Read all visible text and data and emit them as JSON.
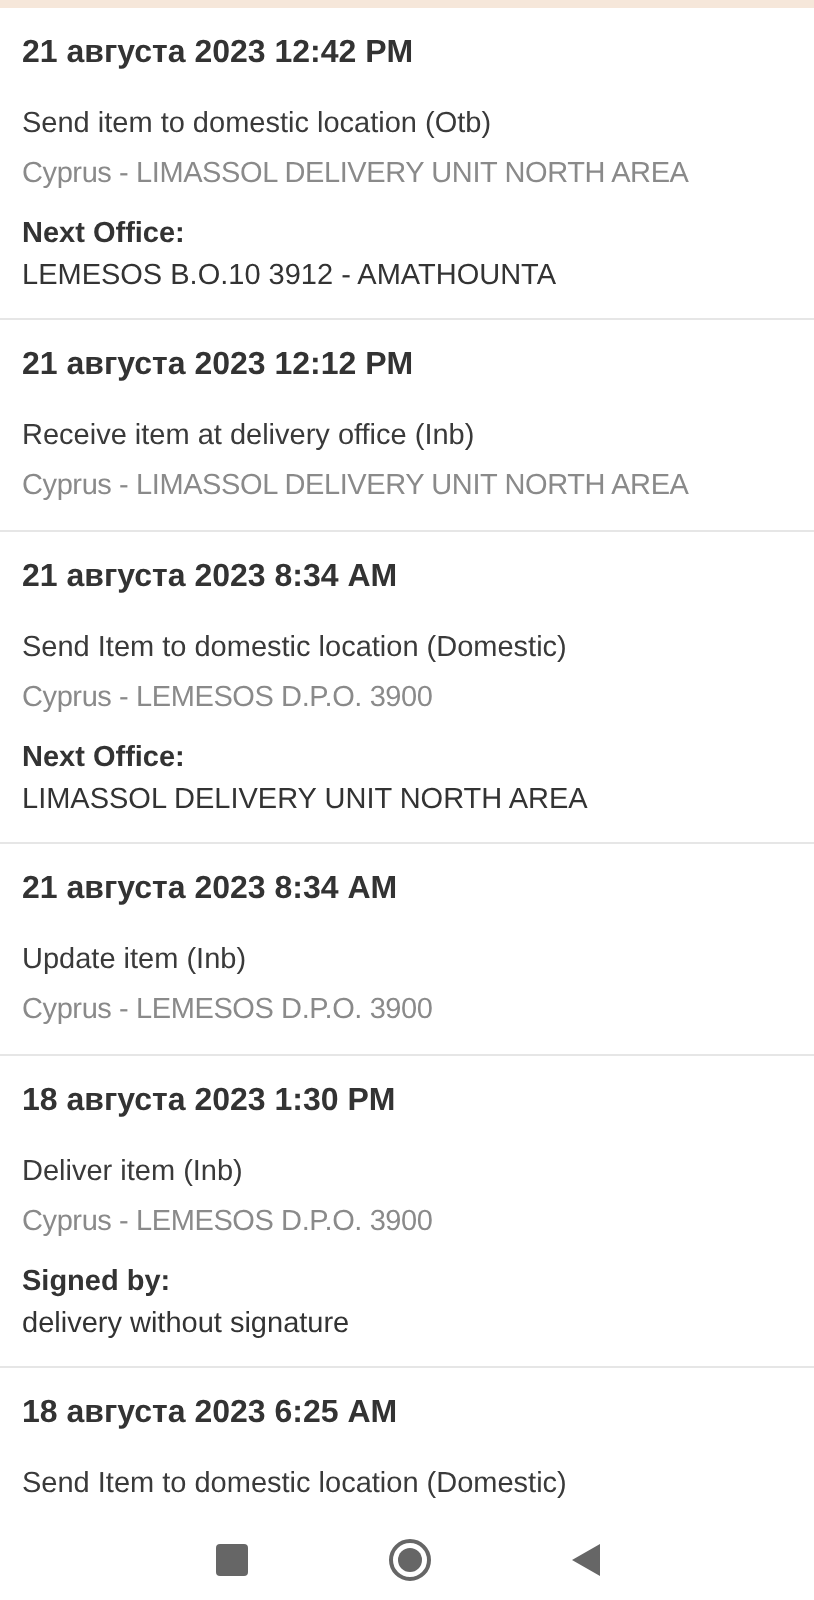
{
  "events": [
    {
      "date": "21 августа 2023 12:42 PM",
      "description": "Send item to domestic location (Otb)",
      "location": "Cyprus - LIMASSOL DELIVERY UNIT NORTH AREA",
      "detail": {
        "label": "Next Office:",
        "value": "LEMESOS B.O.10 3912 - AMATHOUNTA"
      }
    },
    {
      "date": "21 августа 2023 12:12 PM",
      "description": "Receive item at delivery office (Inb)",
      "location": "Cyprus - LIMASSOL DELIVERY UNIT NORTH AREA"
    },
    {
      "date": "21 августа 2023 8:34 AM",
      "description": "Send Item to domestic location (Domestic)",
      "location": "Cyprus - LEMESOS D.P.O. 3900",
      "detail": {
        "label": "Next Office:",
        "value": "LIMASSOL DELIVERY UNIT NORTH AREA"
      }
    },
    {
      "date": "21 августа 2023 8:34 AM",
      "description": "Update item (Inb)",
      "location": "Cyprus - LEMESOS D.P.O. 3900"
    },
    {
      "date": "18 августа 2023 1:30 PM",
      "description": "Deliver item (Inb)",
      "location": "Cyprus - LEMESOS D.P.O. 3900",
      "detail": {
        "label": "Signed by:",
        "value": "delivery without signature"
      }
    },
    {
      "date": "18 августа 2023 6:25 AM",
      "description": "Send Item to domestic location (Domestic)"
    }
  ]
}
